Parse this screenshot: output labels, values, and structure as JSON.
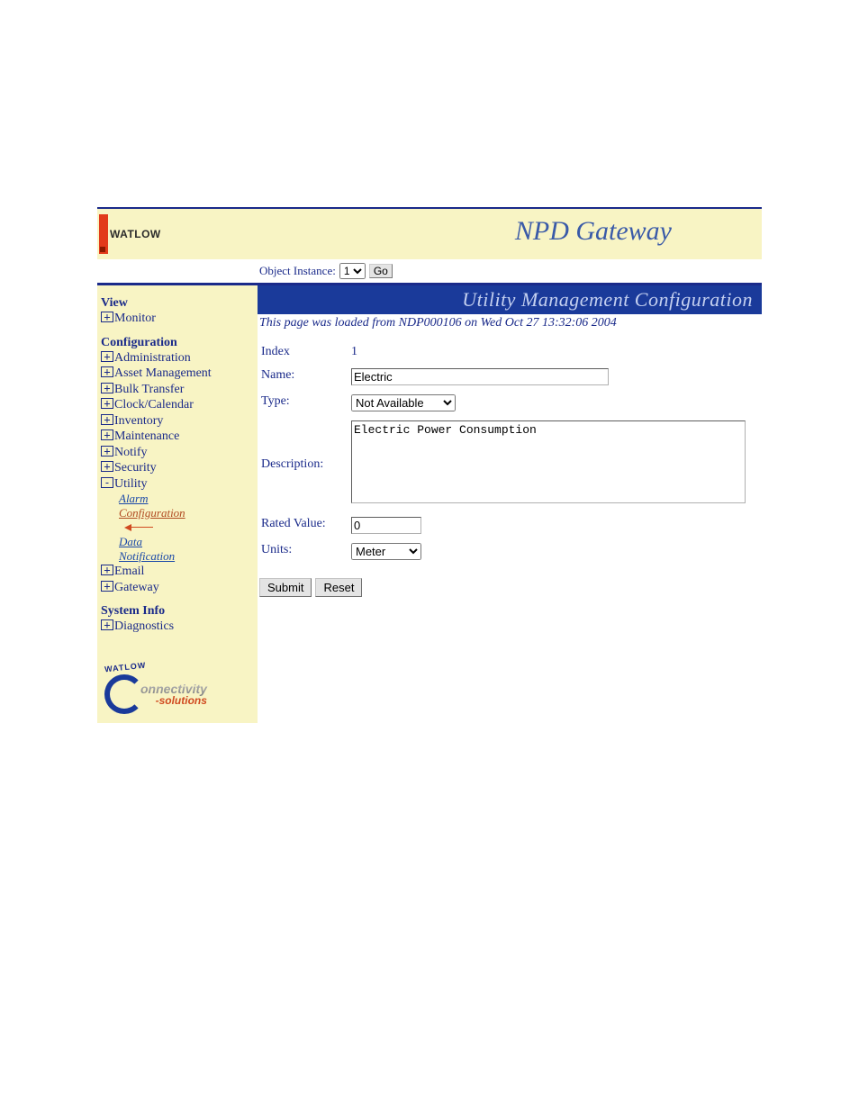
{
  "header": {
    "logo_text": "WATLOW",
    "app_title": "NPD Gateway"
  },
  "instance_bar": {
    "label": "Object Instance:",
    "selected": "1",
    "go_label": "Go"
  },
  "sidebar": {
    "sections": [
      {
        "title": "View",
        "items": [
          {
            "label": "Monitor",
            "expand": "+"
          }
        ]
      },
      {
        "title": "Configuration",
        "items": [
          {
            "label": "Administration",
            "expand": "+"
          },
          {
            "label": "Asset Management",
            "expand": "+"
          },
          {
            "label": "Bulk Transfer",
            "expand": "+"
          },
          {
            "label": "Clock/Calendar",
            "expand": "+"
          },
          {
            "label": "Inventory",
            "expand": "+"
          },
          {
            "label": "Maintenance",
            "expand": "+"
          },
          {
            "label": "Notify",
            "expand": "+"
          },
          {
            "label": "Security",
            "expand": "+"
          },
          {
            "label": "Utility",
            "expand": "-",
            "children": [
              {
                "label": "Alarm"
              },
              {
                "label": "Configuration",
                "active": true
              },
              {
                "label": "Data"
              },
              {
                "label": "Notification"
              }
            ]
          },
          {
            "label": "Email",
            "expand": "+"
          },
          {
            "label": "Gateway",
            "expand": "+"
          }
        ]
      },
      {
        "title": "System Info",
        "items": [
          {
            "label": "Diagnostics",
            "expand": "+"
          }
        ]
      }
    ],
    "conn_logo": {
      "arc": "WATLOW",
      "word1": "onnectivity",
      "word2": "-solutions"
    }
  },
  "main": {
    "title": "Utility Management Configuration",
    "loaded_line": "This page was loaded from NDP000106 on Wed Oct 27 13:32:06 2004",
    "form": {
      "index_label": "Index",
      "index_value": "1",
      "name_label": "Name:",
      "name_value": "Electric",
      "type_label": "Type:",
      "type_value": "Not Available",
      "description_label": "Description:",
      "description_value": "Electric Power Consumption",
      "rated_label": "Rated Value:",
      "rated_value": "0",
      "units_label": "Units:",
      "units_value": "Meter",
      "submit_label": "Submit",
      "reset_label": "Reset"
    }
  }
}
